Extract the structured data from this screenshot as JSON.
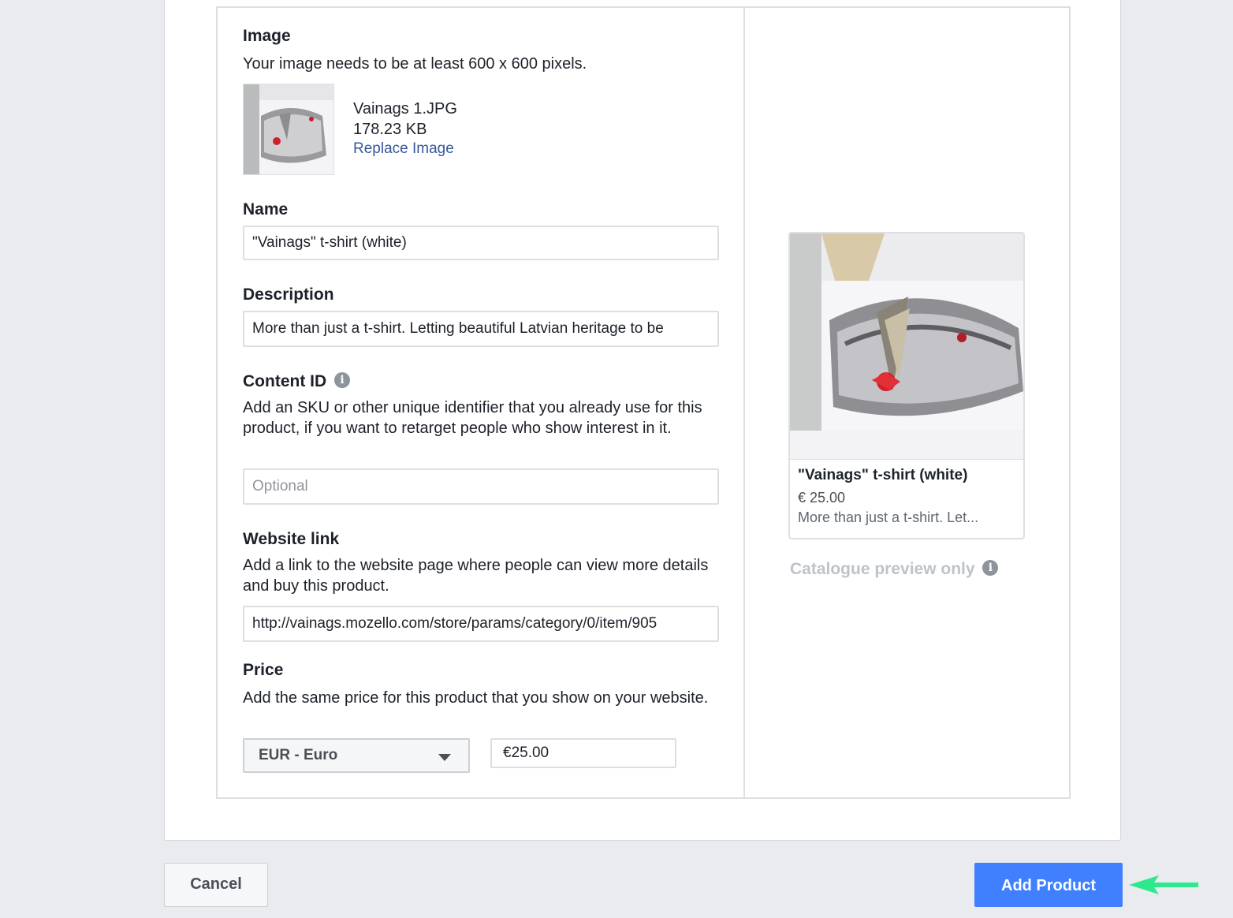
{
  "image_section": {
    "label": "Image",
    "help": "Your image needs to be at least 600 x 600 pixels.",
    "file_name": "Vainags 1.JPG",
    "file_size": "178.23 KB",
    "replace_link": "Replace Image"
  },
  "name_section": {
    "label": "Name",
    "value": "\"Vainags\" t-shirt (white)"
  },
  "description_section": {
    "label": "Description",
    "value": "More than just a t-shirt. Letting beautiful Latvian heritage to be"
  },
  "content_id_section": {
    "label": "Content ID",
    "info_icon": "info-icon",
    "help": "Add an SKU or other unique identifier that you already use for this product, if you want to retarget people who show interest in it.",
    "placeholder": "Optional"
  },
  "website_section": {
    "label": "Website link",
    "help": "Add a link to the website page where people can view more details and buy this product.",
    "value": "http://vainags.mozello.com/store/params/category/0/item/905"
  },
  "price_section": {
    "label": "Price",
    "help": "Add the same price for this product that you show on your website.",
    "currency": "EUR - Euro",
    "value": "€25.00"
  },
  "preview": {
    "title": "\"Vainags\" t-shirt (white)",
    "price": "€ 25.00",
    "description": "More than just a t-shirt. Let...",
    "caption": "Catalogue preview only"
  },
  "footer": {
    "cancel_label": "Cancel",
    "add_label": "Add Product"
  },
  "colors": {
    "accent": "#4080ff",
    "link": "#365899",
    "arrow": "#2ee88e"
  }
}
